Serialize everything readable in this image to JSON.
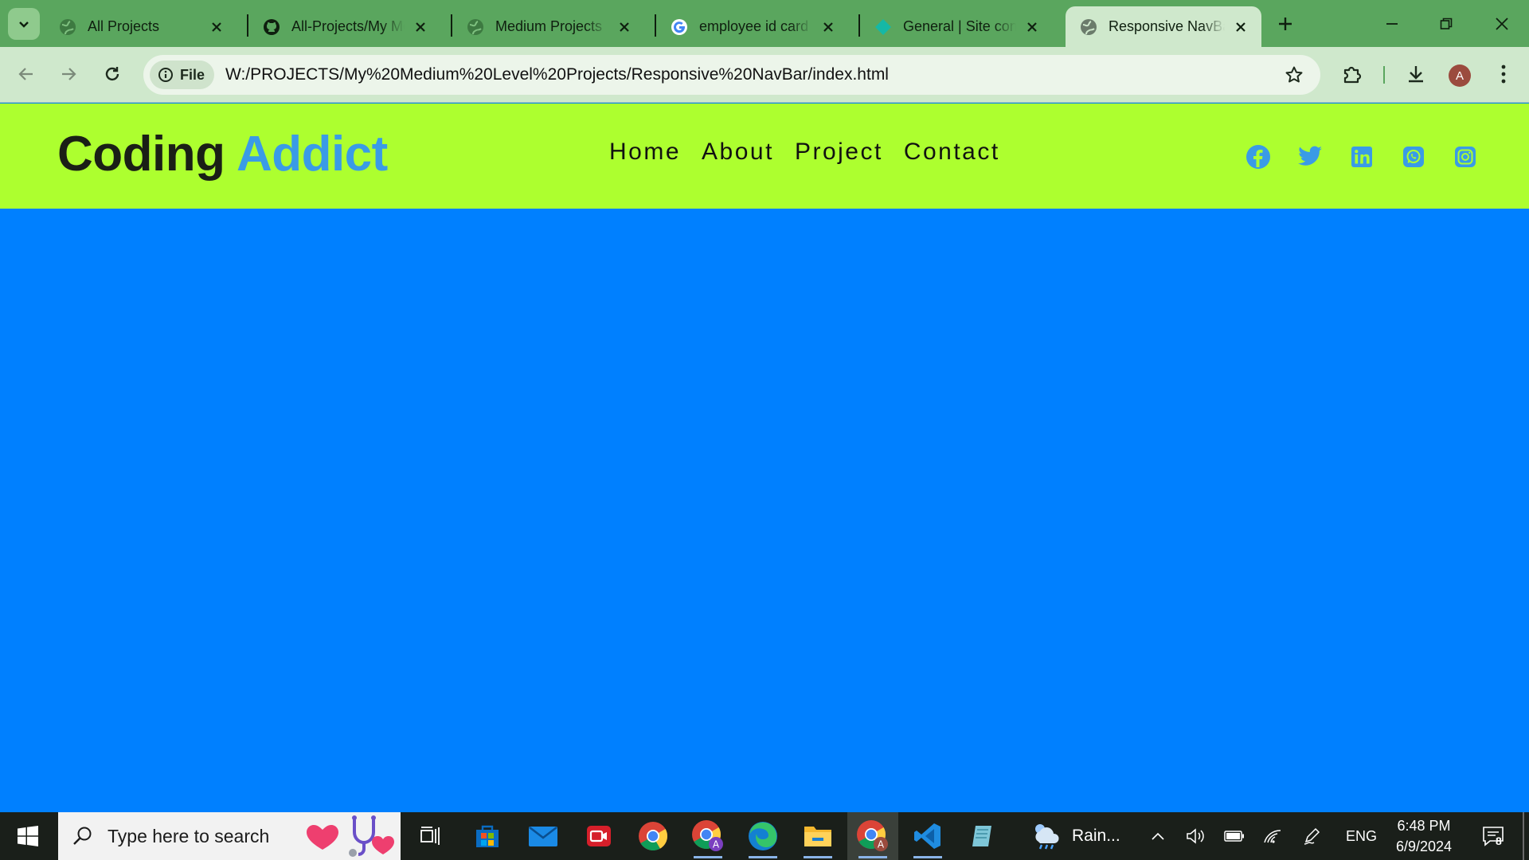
{
  "browser": {
    "tabs": [
      {
        "title": "All Projects",
        "icon": "globe-icon",
        "active": false
      },
      {
        "title": "All-Projects/My Medium Level Projects",
        "icon": "github-icon",
        "active": false
      },
      {
        "title": "Medium Projects",
        "icon": "globe-icon",
        "active": false
      },
      {
        "title": "employee id card",
        "icon": "google-icon",
        "active": false
      },
      {
        "title": "General | Site configuration",
        "icon": "netlify-icon",
        "active": false
      },
      {
        "title": "Responsive NavBar",
        "icon": "globe-icon",
        "active": true
      }
    ],
    "address": {
      "chip_label": "File",
      "url": "W:/PROJECTS/My%20Medium%20Level%20Projects/Responsive%20NavBar/index.html"
    },
    "profile_initial": "A",
    "colors": {
      "tabbar": "#5aa65e",
      "toolbar": "#cfe8cc"
    }
  },
  "page": {
    "logo": {
      "primary": "Coding",
      "accent": "Addict"
    },
    "menu": [
      {
        "label": "Home"
      },
      {
        "label": "About"
      },
      {
        "label": "Project"
      },
      {
        "label": "Contact"
      }
    ],
    "socials": [
      "facebook-icon",
      "twitter-icon",
      "linkedin-icon",
      "whatsapp-icon",
      "instagram-icon"
    ],
    "colors": {
      "navbar_bg": "#adff2f",
      "body_bg": "#0080ff",
      "logo_accent": "#3a9be6",
      "social_icon": "#3a9be6"
    }
  },
  "taskbar": {
    "search_placeholder": "Type here to search",
    "apps": [
      "task-view-icon",
      "microsoft-store-icon",
      "mail-icon",
      "screen-recorder-icon",
      "chrome-icon",
      "chrome-profile-icon",
      "edge-icon",
      "file-explorer-icon",
      "chrome-profile-icon",
      "vscode-icon",
      "notepad-icon"
    ],
    "weather_text": "Rain...",
    "language": "ENG",
    "time": "6:48 PM",
    "date": "6/9/2024",
    "notification_count": "8"
  }
}
